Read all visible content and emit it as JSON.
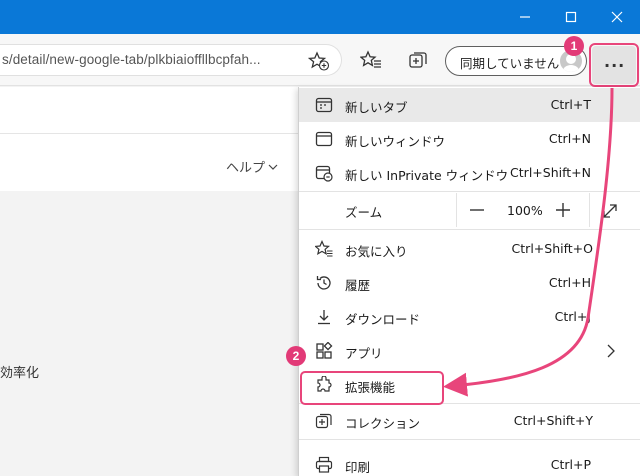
{
  "window": {
    "controls": [
      "minimize-icon",
      "maximize-icon",
      "close-icon"
    ]
  },
  "toolbar": {
    "address": "s/detail/new-google-tab/plkbiaioffllbcpfah...",
    "sync_label": "同期していません",
    "more_label": "···"
  },
  "page": {
    "help": "ヘルプ",
    "efficiency": "効率化"
  },
  "menu": {
    "new_tab": {
      "label": "新しいタブ",
      "shortcut": "Ctrl+T"
    },
    "new_window": {
      "label": "新しいウィンドウ",
      "shortcut": "Ctrl+N"
    },
    "new_inprivate": {
      "label": "新しい InPrivate ウィンドウ",
      "shortcut": "Ctrl+Shift+N"
    },
    "zoom": {
      "label": "ズーム",
      "value": "100%"
    },
    "favorites": {
      "label": "お気に入り",
      "shortcut": "Ctrl+Shift+O"
    },
    "history": {
      "label": "履歴",
      "shortcut": "Ctrl+H"
    },
    "downloads": {
      "label": "ダウンロード",
      "shortcut": "Ctrl+J"
    },
    "apps": {
      "label": "アプリ"
    },
    "extensions": {
      "label": "拡張機能"
    },
    "collections": {
      "label": "コレクション",
      "shortcut": "Ctrl+Shift+Y"
    },
    "print": {
      "label": "印刷",
      "shortcut": "Ctrl+P"
    }
  },
  "annotations": {
    "step1": "1",
    "step2": "2",
    "accent_color": "#e8457b"
  }
}
